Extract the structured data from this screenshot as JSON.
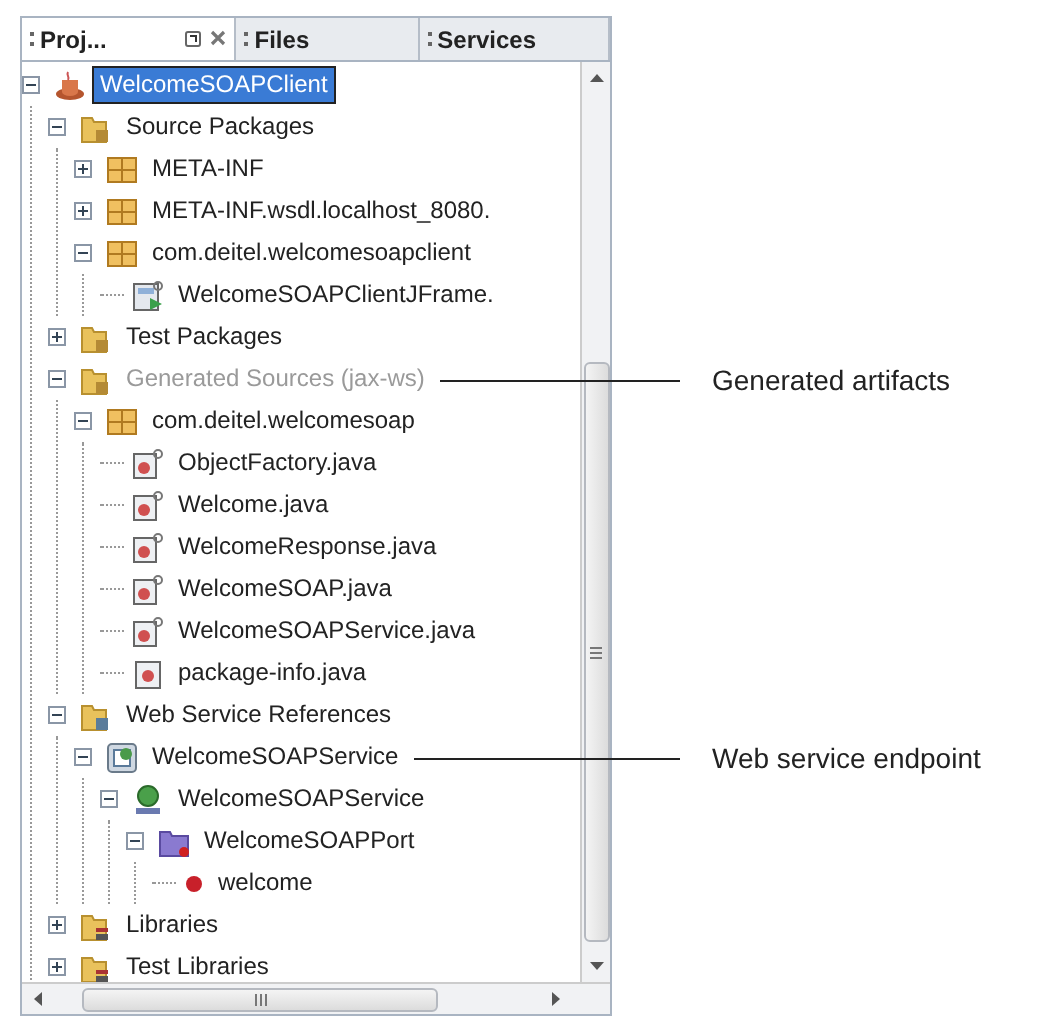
{
  "tabs": [
    {
      "label": "Proj...",
      "selected": true
    },
    {
      "label": "Files",
      "selected": false
    },
    {
      "label": "Services",
      "selected": false
    }
  ],
  "tree": [
    {
      "label": "WelcomeSOAPClient",
      "kind": "project",
      "expanded": true,
      "selected": true,
      "disabled": false,
      "children": [
        {
          "label": "Source Packages",
          "kind": "folder",
          "expanded": true,
          "selected": false,
          "disabled": false,
          "children": [
            {
              "label": "META-INF",
              "kind": "package",
              "expanded": false,
              "selected": false,
              "disabled": false
            },
            {
              "label": "META-INF.wsdl.localhost_8080.",
              "kind": "package",
              "expanded": false,
              "selected": false,
              "disabled": false
            },
            {
              "label": "com.deitel.welcomesoapclient",
              "kind": "package",
              "expanded": true,
              "selected": false,
              "disabled": false,
              "children": [
                {
                  "label": "WelcomeSOAPClientJFrame.",
                  "kind": "form",
                  "selected": false,
                  "disabled": false
                }
              ]
            }
          ]
        },
        {
          "label": "Test Packages",
          "kind": "folder",
          "expanded": false,
          "selected": false,
          "disabled": false
        },
        {
          "label": "Generated Sources (jax-ws)",
          "kind": "folder",
          "expanded": true,
          "selected": false,
          "disabled": true,
          "callout": "Generated artifacts",
          "children": [
            {
              "label": "com.deitel.welcomesoap",
              "kind": "package",
              "expanded": true,
              "selected": false,
              "disabled": false,
              "children": [
                {
                  "label": "ObjectFactory.java",
                  "kind": "source",
                  "selected": false,
                  "disabled": false
                },
                {
                  "label": "Welcome.java",
                  "kind": "source",
                  "selected": false,
                  "disabled": false
                },
                {
                  "label": "WelcomeResponse.java",
                  "kind": "source",
                  "selected": false,
                  "disabled": false
                },
                {
                  "label": "WelcomeSOAP.java",
                  "kind": "source",
                  "selected": false,
                  "disabled": false
                },
                {
                  "label": "WelcomeSOAPService.java",
                  "kind": "source",
                  "selected": false,
                  "disabled": false
                },
                {
                  "label": "package-info.java",
                  "kind": "java",
                  "selected": false,
                  "disabled": false
                }
              ]
            }
          ]
        },
        {
          "label": "Web Service References",
          "kind": "references",
          "expanded": true,
          "selected": false,
          "disabled": false,
          "children": [
            {
              "label": "WelcomeSOAPService",
              "kind": "client",
              "expanded": true,
              "selected": false,
              "disabled": false,
              "callout": "Web service endpoint",
              "children": [
                {
                  "label": "WelcomeSOAPService",
                  "kind": "service",
                  "expanded": true,
                  "selected": false,
                  "disabled": false,
                  "children": [
                    {
                      "label": "WelcomeSOAPPort",
                      "kind": "port",
                      "expanded": true,
                      "selected": false,
                      "disabled": false,
                      "children": [
                        {
                          "label": "welcome",
                          "kind": "operation",
                          "selected": false,
                          "disabled": false
                        }
                      ]
                    }
                  ]
                }
              ]
            }
          ]
        },
        {
          "label": "Libraries",
          "kind": "libraries",
          "expanded": false,
          "selected": false,
          "disabled": false
        },
        {
          "label": "Test Libraries",
          "kind": "libraries",
          "expanded": false,
          "selected": false,
          "disabled": false
        }
      ]
    }
  ]
}
